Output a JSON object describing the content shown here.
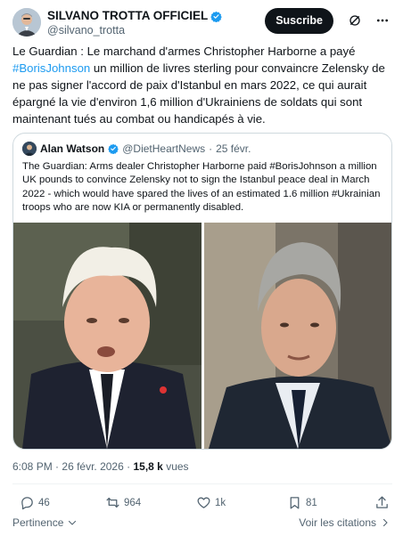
{
  "author": {
    "name": "SILVANO TROTTA OFFICIEL",
    "handle": "@silvano_trotta"
  },
  "subscribe_label": "Suscribe",
  "tweet": {
    "text_before": "Le Guardian : Le marchand d'armes Christopher Harborne a payé ",
    "hashtag": "#BorisJohnson",
    "text_after": " un million de livres sterling pour convaincre Zelensky de ne pas signer l'accord de paix d'Istanbul en mars 2022, ce qui aurait épargné la vie d'environ 1,6 million d'Ukrainiens de soldats qui sont maintenant tués au combat ou handicapés à vie."
  },
  "quote": {
    "name": "Alan Watson",
    "handle": "@DietHeartNews",
    "separator": "·",
    "date": "25 févr.",
    "text": "The Guardian: Arms dealer Christopher Harborne paid #BorisJohnson a million UK pounds to convince Zelensky not to sign the Istanbul peace deal in March 2022 - which would have spared the lives of an estimated 1.6 million #Ukrainian troops who are now KIA or permanently disabled."
  },
  "meta": {
    "time": "6:08 PM",
    "separator1": "·",
    "date": "26 févr. 2026",
    "separator2": "·",
    "views_count": "15,8 k",
    "views_label": "vues"
  },
  "actions": {
    "replies": "46",
    "reposts": "964",
    "likes": "1k",
    "views": "81"
  },
  "footer": {
    "relevance": "Pertinence",
    "quotes_link": "Voir les citations"
  },
  "colors": {
    "accent": "#1d9bf0",
    "text": "#0f1419",
    "muted": "#536471",
    "border": "#cfd9de"
  }
}
